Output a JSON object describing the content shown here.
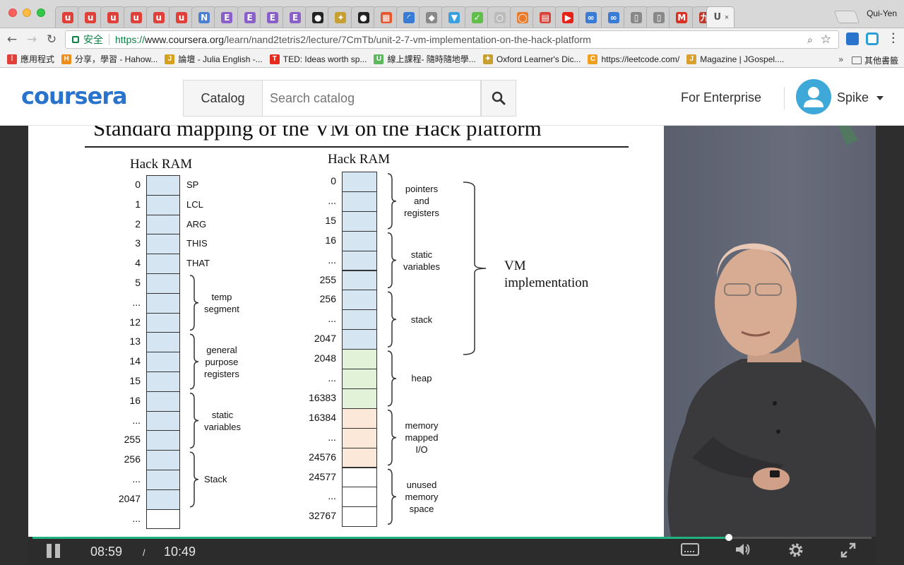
{
  "browser": {
    "profile": "Qui-Yen",
    "tabs": [
      {
        "icon": "udemy-icon",
        "glyph": "u",
        "color": "#e0403a"
      },
      {
        "icon": "udemy-icon",
        "glyph": "u",
        "color": "#e0403a"
      },
      {
        "icon": "udemy-icon",
        "glyph": "u",
        "color": "#e0403a"
      },
      {
        "icon": "udemy-icon",
        "glyph": "u",
        "color": "#e0403a"
      },
      {
        "icon": "udemy-icon",
        "glyph": "u",
        "color": "#e0403a"
      },
      {
        "icon": "udemy-icon",
        "glyph": "u",
        "color": "#e0403a"
      },
      {
        "icon": "nb-icon",
        "glyph": "N",
        "color": "#4a7fd1"
      },
      {
        "icon": "e-icon",
        "glyph": "E",
        "color": "#8a5fc9"
      },
      {
        "icon": "e-icon",
        "glyph": "E",
        "color": "#8a5fc9"
      },
      {
        "icon": "e-icon",
        "glyph": "E",
        "color": "#8a5fc9"
      },
      {
        "icon": "e-icon",
        "glyph": "E",
        "color": "#8a5fc9"
      },
      {
        "icon": "github-icon",
        "glyph": "●",
        "color": "#222222"
      },
      {
        "icon": "pinwheel-icon",
        "glyph": "✦",
        "color": "#c8a030"
      },
      {
        "icon": "github-icon",
        "glyph": "●",
        "color": "#222222"
      },
      {
        "icon": "windows-icon",
        "glyph": "▦",
        "color": "#e6562f"
      },
      {
        "icon": "loading-icon",
        "glyph": "◜",
        "color": "#3a7bd5"
      },
      {
        "icon": "stack-icon",
        "glyph": "◆",
        "color": "#888888"
      },
      {
        "icon": "filter-icon",
        "glyph": "▼",
        "color": "#3aa0e0"
      },
      {
        "icon": "check-icon",
        "glyph": "✓",
        "color": "#5fbf4a"
      },
      {
        "icon": "circle-icon",
        "glyph": "○",
        "color": "#bbbbbb"
      },
      {
        "icon": "circle-icon",
        "glyph": "◯",
        "color": "#e87a2a"
      },
      {
        "icon": "calendar-icon",
        "glyph": "▤",
        "color": "#d9443a"
      },
      {
        "icon": "youtube-icon",
        "glyph": "▶",
        "color": "#e62117"
      },
      {
        "icon": "infinity-icon",
        "glyph": "∞",
        "color": "#3a7bd5"
      },
      {
        "icon": "infinity-icon",
        "glyph": "∞",
        "color": "#3a7bd5"
      },
      {
        "icon": "page-icon",
        "glyph": "▯",
        "color": "#888888"
      },
      {
        "icon": "page-icon",
        "glyph": "▯",
        "color": "#888888"
      },
      {
        "icon": "gmail-icon",
        "glyph": "M",
        "color": "#d93025"
      },
      {
        "icon": "hanzi-icon",
        "glyph": "九",
        "color": "#c0392b"
      }
    ],
    "active_tab": {
      "glyph": "U",
      "close": "×"
    },
    "secure_label": "安全",
    "url_scheme": "https://",
    "url_host": "www.coursera.org",
    "url_path": "/learn/nand2tetris2/lecture/7CmTb/unit-2-7-vm-implementation-on-the-hack-platform",
    "bookmarks": [
      {
        "label": "應用程式",
        "color": "#e0403a",
        "glyph": "⁞"
      },
      {
        "label": "分享，學習 - Hahow...",
        "color": "#f08c1a",
        "glyph": "H"
      },
      {
        "label": "論壇 - Julia English -...",
        "color": "#d6a21e",
        "glyph": "J"
      },
      {
        "label": "TED: Ideas worth sp...",
        "color": "#e62b1e",
        "glyph": "T"
      },
      {
        "label": "線上課程- 隨時隨地學...",
        "color": "#5cb85c",
        "glyph": "U"
      },
      {
        "label": "Oxford Learner's Dic...",
        "color": "#c8a030",
        "glyph": "✦"
      },
      {
        "label": "https://leetcode.com/",
        "color": "#f0a020",
        "glyph": "C"
      },
      {
        "label": "Magazine | JGospel....",
        "color": "#d9a030",
        "glyph": "J"
      }
    ],
    "more": "»",
    "folder": "其他書籤"
  },
  "site": {
    "logo": "coursera",
    "catalog": "Catalog",
    "search_placeholder": "Search catalog",
    "enterprise": "For Enterprise",
    "user": "Spike"
  },
  "slide": {
    "title": "Standard mapping of the VM on the Hack platform",
    "left_head": "Hack RAM",
    "right_head": "Hack RAM",
    "left_addrs": [
      "0",
      "1",
      "2",
      "3",
      "4",
      "5",
      "...",
      "12",
      "13",
      "14",
      "15",
      "16",
      "...",
      "255",
      "256",
      "...",
      "2047",
      "..."
    ],
    "left_regs": [
      "SP",
      "LCL",
      "ARG",
      "THIS",
      "THAT"
    ],
    "left_groups": [
      "temp\nsegment",
      "general\npurpose\nregisters",
      "static\nvariables",
      "Stack"
    ],
    "right_addrs": [
      "0",
      "...",
      "15",
      "16",
      "...",
      "255",
      "256",
      "...",
      "2047",
      "2048",
      "...",
      "16383",
      "16384",
      "...",
      "24576",
      "24577",
      "...",
      "32767"
    ],
    "right_groups": [
      "pointers\nand\nregisters",
      "static\nvariables",
      "stack",
      "heap",
      "memory\nmapped\nI/O",
      "unused\nmemory\nspace"
    ],
    "vm_label": "VM\nimplementation",
    "colors": {
      "blue": "#d5e5f2",
      "green": "#e2f2d8",
      "peach": "#fbe8d8",
      "white": "#ffffff"
    }
  },
  "player": {
    "current_time": "08:59",
    "slash": "/",
    "duration": "10:49",
    "progress": 0.83,
    "accent": "#21b07f"
  }
}
